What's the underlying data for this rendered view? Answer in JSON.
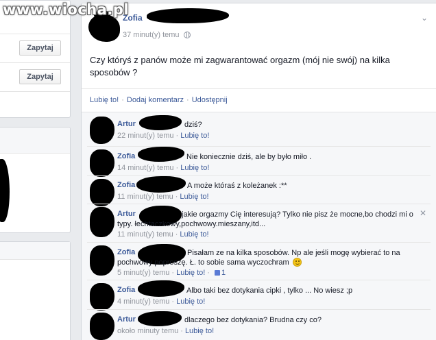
{
  "watermark": {
    "text": "www.wiocha.pl"
  },
  "left": {
    "ask_buttons": [
      "Zapytaj",
      "Zapytaj"
    ]
  },
  "post": {
    "author": "Zofia",
    "time": "37 minut(y) temu",
    "text": "Czy któryś z panów może mi zagwarantować orgazm (mój nie swój) na kilka sposobów ?",
    "actions": {
      "like": "Lubię to!",
      "comment": "Dodaj komentarz",
      "share": "Udostępnij",
      "separator": "·"
    }
  },
  "comments": [
    {
      "author": "Artur",
      "text": "dziś?",
      "time": "22 minut(y) temu",
      "like": "Lubię to!"
    },
    {
      "author": "Zofia",
      "text": "Nie koniecznie dziś, ale by było miło .",
      "time": "14 minut(y) temu",
      "like": "Lubię to!"
    },
    {
      "author": "Zofia",
      "text": "A może któraś z koleżanek :**",
      "time": "11 minut(y) temu",
      "like": "Lubię to!"
    },
    {
      "author": "Artur",
      "text_line1": "jakie orgazmy Cię interesują? Tylko nie pisz że mocne,bo chodzi mi o",
      "text_line2": "typy. łechtaczkowy,pochwowy.mieszany,itd...",
      "time": "11 minut(y) temu",
      "like": "Lubię to!"
    },
    {
      "author": "Zofia",
      "text_line1": "Pisałam ze na kilka sposobów. Np ale jeśli mogę wybierać to na",
      "text_line2": "pochwowy poproszę. Ł. to sobie sama wyczochram",
      "time": "5 minut(y) temu",
      "like": "Lubię to!",
      "likes_count": "1"
    },
    {
      "author": "Zofia",
      "text": "Albo taki bez dotykania cipki , tylko ... No wiesz ;p",
      "time": "4 minut(y) temu",
      "like": "Lubię to!"
    },
    {
      "author": "Artur",
      "text": "dlaczego bez dotykania? Brudna czy co?",
      "time": "około minuty temu",
      "like": "Lubię to!"
    }
  ]
}
